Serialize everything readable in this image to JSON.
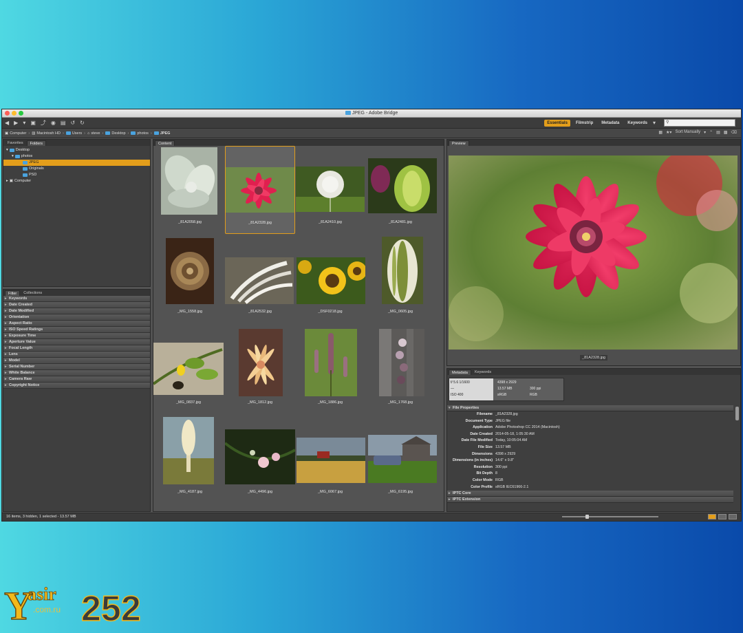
{
  "window": {
    "title": "JPEG - Adobe Bridge"
  },
  "workspaces": [
    {
      "label": "Essentials",
      "active": true
    },
    {
      "label": "Filmstrip",
      "active": false
    },
    {
      "label": "Metadata",
      "active": false
    },
    {
      "label": "Keywords",
      "active": false
    }
  ],
  "search": {
    "value": "",
    "placeholder": ""
  },
  "path": [
    "Computer",
    "Macintosh HD",
    "Users",
    "steve",
    "Desktop",
    "photos",
    "JPEG"
  ],
  "sort": {
    "label": "Sort Manually"
  },
  "panels": {
    "left_tabs": [
      "Favorites",
      "Folders"
    ],
    "filter_tabs": [
      "Filter",
      "Collections"
    ],
    "content_tab": "Content",
    "preview_tab": "Preview",
    "meta_tabs": [
      "Metadata",
      "Keywords"
    ]
  },
  "folders": [
    {
      "label": "Desktop",
      "indent": 1,
      "selected": false
    },
    {
      "label": "photos",
      "indent": 2,
      "selected": false
    },
    {
      "label": "JPEG",
      "indent": 3,
      "selected": true
    },
    {
      "label": "Originals",
      "indent": 3,
      "selected": false
    },
    {
      "label": "PSD",
      "indent": 3,
      "selected": false
    },
    {
      "label": "Computer",
      "indent": 1,
      "selected": false
    }
  ],
  "filters": [
    "Keywords",
    "Date Created",
    "Date Modified",
    "Orientation",
    "Aspect Ratio",
    "ISO Speed Ratings",
    "Exposure Time",
    "Aperture Value",
    "Focal Length",
    "Lens",
    "Model",
    "Serial Number",
    "White Balance",
    "Camera Raw",
    "Copyright Notice"
  ],
  "thumbnails": [
    {
      "name": "_81A2058.jpg",
      "selected": false,
      "kind": "succulent"
    },
    {
      "name": "_81A2328.jpg",
      "selected": true,
      "kind": "dahlia"
    },
    {
      "name": "_81A2410.jpg",
      "selected": false,
      "kind": "dandelion"
    },
    {
      "name": "_81A2481.jpg",
      "selected": false,
      "kind": "bud"
    },
    {
      "name": "_MG_1558.jpg",
      "selected": false,
      "kind": "rose"
    },
    {
      "name": "_81A2532.jpg",
      "selected": false,
      "kind": "white-petals"
    },
    {
      "name": "_DSF0218.jpg",
      "selected": false,
      "kind": "sunflowers"
    },
    {
      "name": "_MG_0605.jpg",
      "selected": false,
      "kind": "leaf"
    },
    {
      "name": "_MG_0837.jpg",
      "selected": false,
      "kind": "bee"
    },
    {
      "name": "_MG_1812.jpg",
      "selected": false,
      "kind": "yellow-bloom"
    },
    {
      "name": "_MG_1886.jpg",
      "selected": false,
      "kind": "cattail"
    },
    {
      "name": "_MG_1768.jpg",
      "selected": false,
      "kind": "orchid"
    },
    {
      "name": "_MG_4187.jpg",
      "selected": false,
      "kind": "wildflower"
    },
    {
      "name": "_MG_4496.jpg",
      "selected": false,
      "kind": "pink-blossoms"
    },
    {
      "name": "_MG_6067.jpg",
      "selected": false,
      "kind": "field"
    },
    {
      "name": "_MG_6195.jpg",
      "selected": false,
      "kind": "barn"
    }
  ],
  "preview": {
    "caption": "_81A2328.jpg"
  },
  "meta_summary": {
    "left": [
      "f/ 5.6    1/1600",
      "—",
      "ISO 400"
    ],
    "right": [
      [
        "4398 x 2929",
        ""
      ],
      [
        "13.57 MB",
        "300 ppi"
      ],
      [
        "sRGB",
        "RGB"
      ]
    ]
  },
  "file_properties": {
    "title": "File Properties",
    "rows": [
      {
        "key": "Filename",
        "value": "_81A2328.jpg"
      },
      {
        "key": "Document Type",
        "value": "JPEG file"
      },
      {
        "key": "Application",
        "value": "Adobe Photoshop CC 2014 (Macintosh)"
      },
      {
        "key": "Date Created",
        "value": "2014-05-18, 1:05:30 AM"
      },
      {
        "key": "Date File Modified",
        "value": "Today, 10:05:04 AM"
      },
      {
        "key": "File Size",
        "value": "13.57 MB"
      },
      {
        "key": "Dimensions",
        "value": "4398 x 2929"
      },
      {
        "key": "Dimensions (in inches)",
        "value": "14.6\" x 9.8\""
      },
      {
        "key": "Resolution",
        "value": "300 ppi"
      },
      {
        "key": "Bit Depth",
        "value": "8"
      },
      {
        "key": "Color Mode",
        "value": "RGB"
      },
      {
        "key": "Color Profile",
        "value": "sRGB IEC61966-2.1"
      }
    ]
  },
  "more_sections": [
    "IPTC Core",
    "IPTC Extension"
  ],
  "status": {
    "text": "16 items, 3 hidden, 1 selected - 13.57 MB"
  },
  "logo": {
    "text": "Yasir252",
    "sub": ".com.ru"
  }
}
